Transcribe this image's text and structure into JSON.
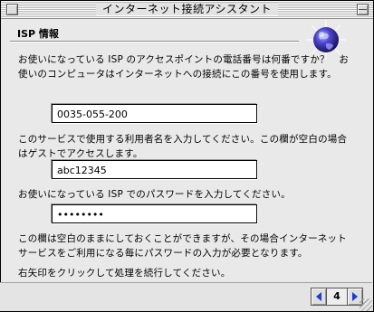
{
  "window": {
    "title": "インターネット接続アシスタント"
  },
  "section": {
    "title": "ISP 情報"
  },
  "phone": {
    "prompt": "お使いになっている ISP のアクセスポイントの電話番号は何番ですか？　お使いのコンピュータはインターネットへの接続にこの番号を使用します。",
    "value": "0035-055-200"
  },
  "username": {
    "prompt": "このサービスで使用する利用者名を入力してください。この欄が空白の場合はゲストでアクセスします。",
    "value": "abc12345"
  },
  "password": {
    "prompt": "お使いになっている ISP でのパスワードを入力してください。",
    "value": "••••••••"
  },
  "notes": {
    "blank_note": "この欄は空白のままにしておくことができますが、その場合インターネットサービスをご利用になる毎にパスワードの入力が必要となります。",
    "continue_note": "右矢印をクリックして処理を続行してください。"
  },
  "navigation": {
    "page": "4"
  },
  "icons": {
    "globe": "globe-icon",
    "accent": "#1d3cc7"
  }
}
